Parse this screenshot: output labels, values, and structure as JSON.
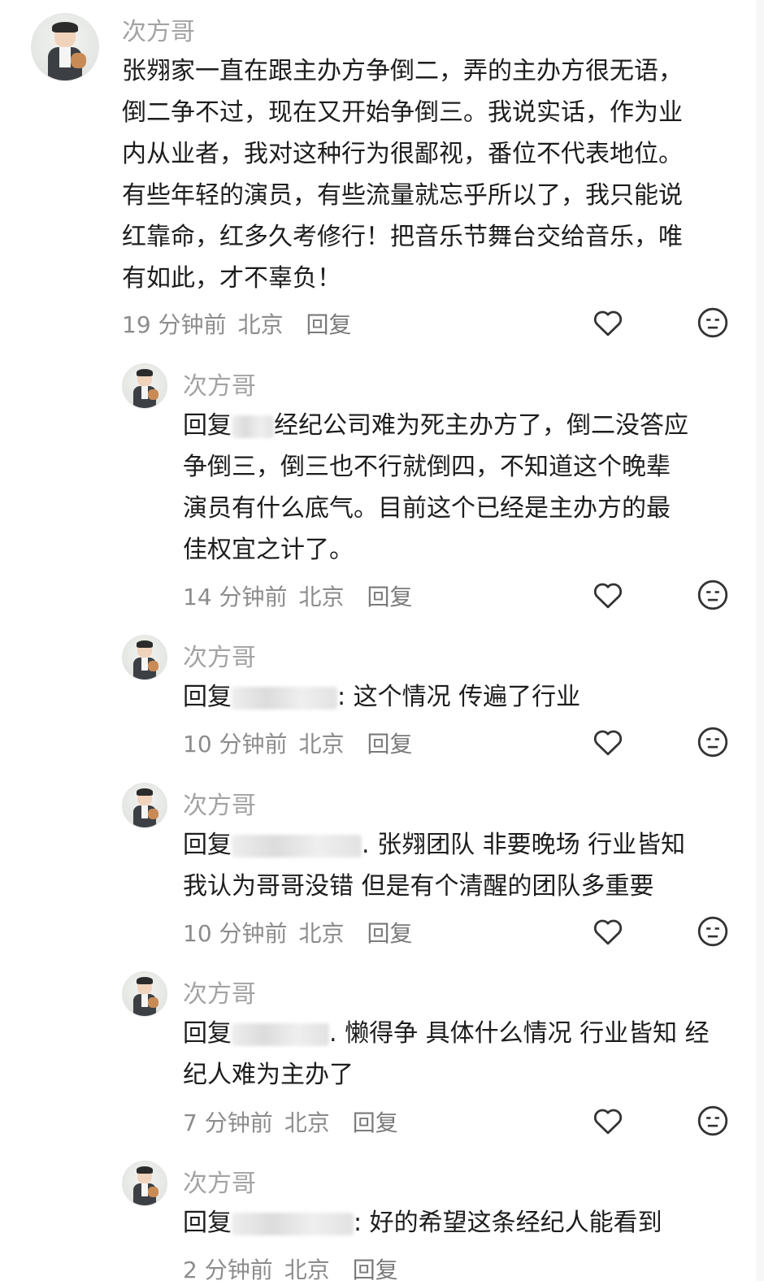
{
  "comments": [
    {
      "author": "次方哥",
      "lines": [
        "张翙家一直在跟主办方争倒二，弄的主办方很无语，",
        "倒二争不过，现在又开始争倒三。我说实话，作为业",
        "内从业者，我对这种行为很鄙视，番位不代表地位。",
        "有些年轻的演员，有些流量就忘乎所以了，我只能说",
        "红靠命，红多久考修行！把音乐节舞台交给音乐，唯",
        "有如此，才不辜负！"
      ],
      "time": "19 分钟前",
      "location": "北京",
      "reply_label": "回复"
    },
    {
      "author": "次方哥",
      "reply_prefix": "回复",
      "reply_suffix": "经纪公司难为死主办方了，倒二没答应",
      "lines": [
        "争倒三，倒三也不行就倒四，不知道这个晚辈",
        "演员有什么底气。目前这个已经是主办方的最",
        "佳权宜之计了。"
      ],
      "time": "14 分钟前",
      "location": "北京",
      "reply_label": "回复"
    },
    {
      "author": "次方哥",
      "reply_prefix": "回复",
      "reply_suffix": ": 这个情况 传遍了行业",
      "lines": [],
      "time": "10 分钟前",
      "location": "北京",
      "reply_label": "回复"
    },
    {
      "author": "次方哥",
      "reply_prefix": "回复",
      "reply_suffix": ". 张翙团队 非要晚场 行业皆知",
      "lines": [
        "我认为哥哥没错 但是有个清醒的团队多重要"
      ],
      "time": "10 分钟前",
      "location": "北京",
      "reply_label": "回复"
    },
    {
      "author": "次方哥",
      "reply_prefix": "回复",
      "reply_suffix": ". 懒得争 具体什么情况 行业皆知 经",
      "lines": [
        "纪人难为主办了"
      ],
      "time": "7 分钟前",
      "location": "北京",
      "reply_label": "回复"
    },
    {
      "author": "次方哥",
      "reply_prefix": "回复",
      "reply_suffix": ": 好的希望这条经纪人能看到",
      "lines": [],
      "time": "2 分钟前",
      "location": "北京",
      "reply_label": "回复"
    }
  ],
  "icons": {
    "like": "heart-outline-icon",
    "react": "meh-face-icon"
  },
  "colors": {
    "name": "#a3a3a3",
    "text": "#1d1d1d",
    "meta": "#8c8c8c",
    "icon": "#333333"
  }
}
